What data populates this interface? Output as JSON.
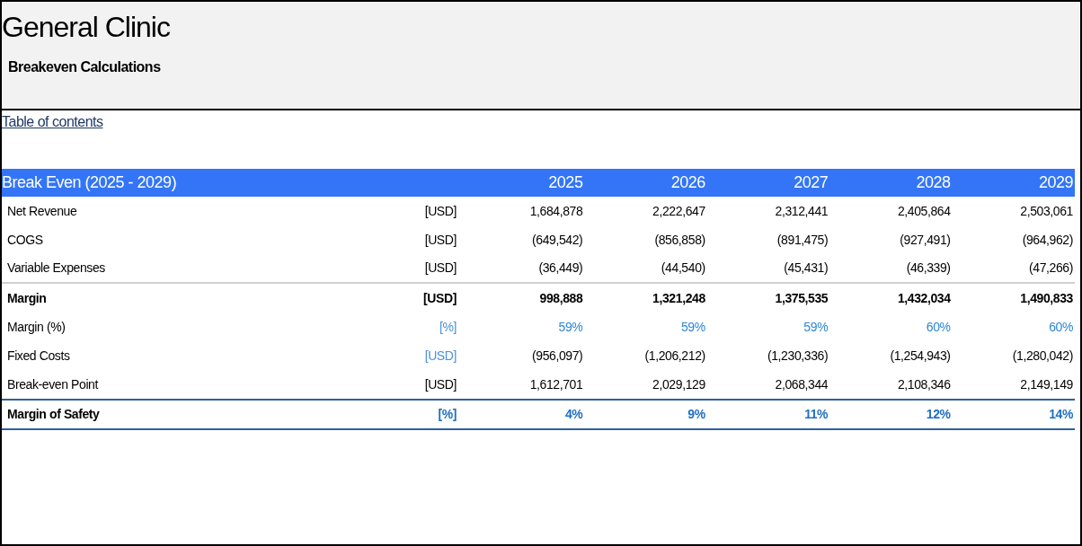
{
  "header": {
    "title": "General Clinic",
    "subtitle": "Breakeven Calculations"
  },
  "toc_link": "Table of contents",
  "table": {
    "title": "Break Even (2025 - 2029)",
    "columns": [
      "2025",
      "2026",
      "2027",
      "2028",
      "2029"
    ],
    "rows": [
      {
        "kind": "item",
        "label": "Net Revenue",
        "unit": "[USD]",
        "values": [
          "1,684,878",
          "2,222,647",
          "2,312,441",
          "2,405,864",
          "2,503,061"
        ]
      },
      {
        "kind": "item",
        "label": "COGS",
        "unit": "[USD]",
        "values": [
          "(649,542)",
          "(856,858)",
          "(891,475)",
          "(927,491)",
          "(964,962)"
        ]
      },
      {
        "kind": "item",
        "label": "Variable Expenses",
        "unit": "[USD]",
        "values": [
          "(36,449)",
          "(44,540)",
          "(45,431)",
          "(46,339)",
          "(47,266)"
        ]
      },
      {
        "kind": "subtotal",
        "label": "Margin",
        "unit": "[USD]",
        "values": [
          "998,888",
          "1,321,248",
          "1,375,535",
          "1,432,034",
          "1,490,833"
        ]
      },
      {
        "kind": "ratio",
        "label": "Margin (%)",
        "unit": "[%]",
        "values": [
          "59%",
          "59%",
          "59%",
          "60%",
          "60%"
        ]
      },
      {
        "kind": "input",
        "label": "Fixed Costs",
        "unit": "[USD]",
        "values": [
          "(956,097)",
          "(1,206,212)",
          "(1,230,336)",
          "(1,254,943)",
          "(1,280,042)"
        ]
      },
      {
        "kind": "item",
        "label": "Break-even Point",
        "unit": "[USD]",
        "values": [
          "1,612,701",
          "2,029,129",
          "2,068,344",
          "2,108,346",
          "2,149,149"
        ]
      },
      {
        "kind": "total",
        "label": "Margin of Safety",
        "unit": "[%]",
        "values": [
          "4%",
          "9%",
          "11%",
          "12%",
          "14%"
        ]
      }
    ]
  }
}
